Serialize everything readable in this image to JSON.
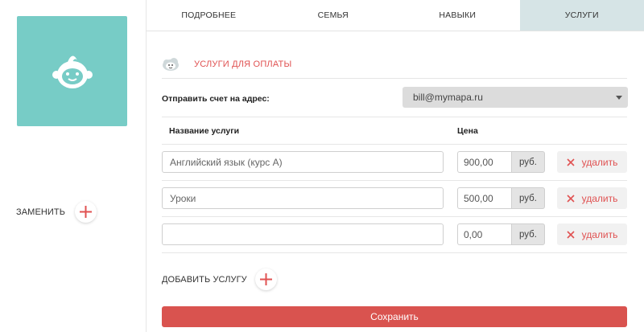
{
  "sidebar": {
    "avatar_icon": "baby-face-icon",
    "replace_label": "ЗАМЕНИТЬ"
  },
  "tabs": [
    {
      "label": "ПОДРОБНЕЕ",
      "active": false
    },
    {
      "label": "СЕМЬЯ",
      "active": false
    },
    {
      "label": "НАВЫКИ",
      "active": false
    },
    {
      "label": "УСЛУГИ",
      "active": true
    }
  ],
  "section": {
    "icon": "cloud-face-icon",
    "title": "УСЛУГИ ДЛЯ ОПЛАТЫ"
  },
  "invoice": {
    "label": "Отправить счет на адрес:",
    "email": "bill@mymapa.ru"
  },
  "table": {
    "col_name": "Название услуги",
    "col_price": "Цена"
  },
  "services": [
    {
      "name": "Английский язык (курс А)",
      "price": "900,00",
      "unit": "руб.",
      "delete_label": "удалить"
    },
    {
      "name": "Уроки",
      "price": "500,00",
      "unit": "руб.",
      "delete_label": "удалить"
    },
    {
      "name": "",
      "price": "0,00",
      "unit": "руб.",
      "delete_label": "удалить"
    }
  ],
  "add_service_label": "ДОБАВИТЬ УСЛУГУ",
  "save_label": "Сохранить",
  "colors": {
    "accent": "#d9534f",
    "avatar_bg": "#77ccc6",
    "active_tab": "#d6e4e6"
  }
}
